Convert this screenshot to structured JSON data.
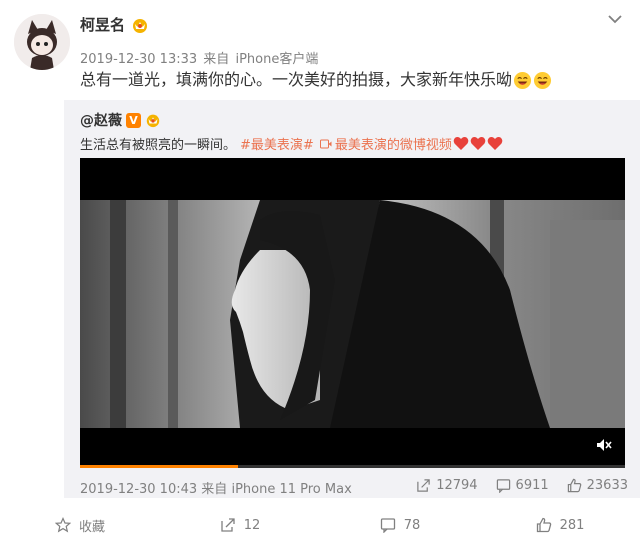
{
  "post": {
    "author": "柯昱名",
    "time": "2019-12-30 13:33",
    "source_prefix": "来自",
    "source": "iPhone客户端",
    "text": "总有一道光，填满你的心。一次美好的拍摄，大家新年快乐呦",
    "emojis": [
      "laugh-emoji",
      "laugh-emoji"
    ]
  },
  "repost": {
    "author": "@赵薇",
    "verified_badge": "V",
    "text": "生活总有被照亮的一瞬间。",
    "topic1": "#最美表演#",
    "video_link": "最美表演的微博视频",
    "hearts": 3,
    "video": {
      "progress_percent": 29,
      "muted": true
    },
    "time": "2019-12-30 10:43",
    "source_prefix": "来自",
    "source": "iPhone 11 Pro Max",
    "stats": {
      "reposts": "12794",
      "comments": "6911",
      "likes": "23633"
    }
  },
  "actions": {
    "favorite": "收藏",
    "repost": "12",
    "comment": "78",
    "like": "281"
  },
  "colors": {
    "accent": "#eb7350",
    "orange": "#ff8200",
    "muted": "#808080",
    "repost_bg": "#f2f2f5"
  }
}
